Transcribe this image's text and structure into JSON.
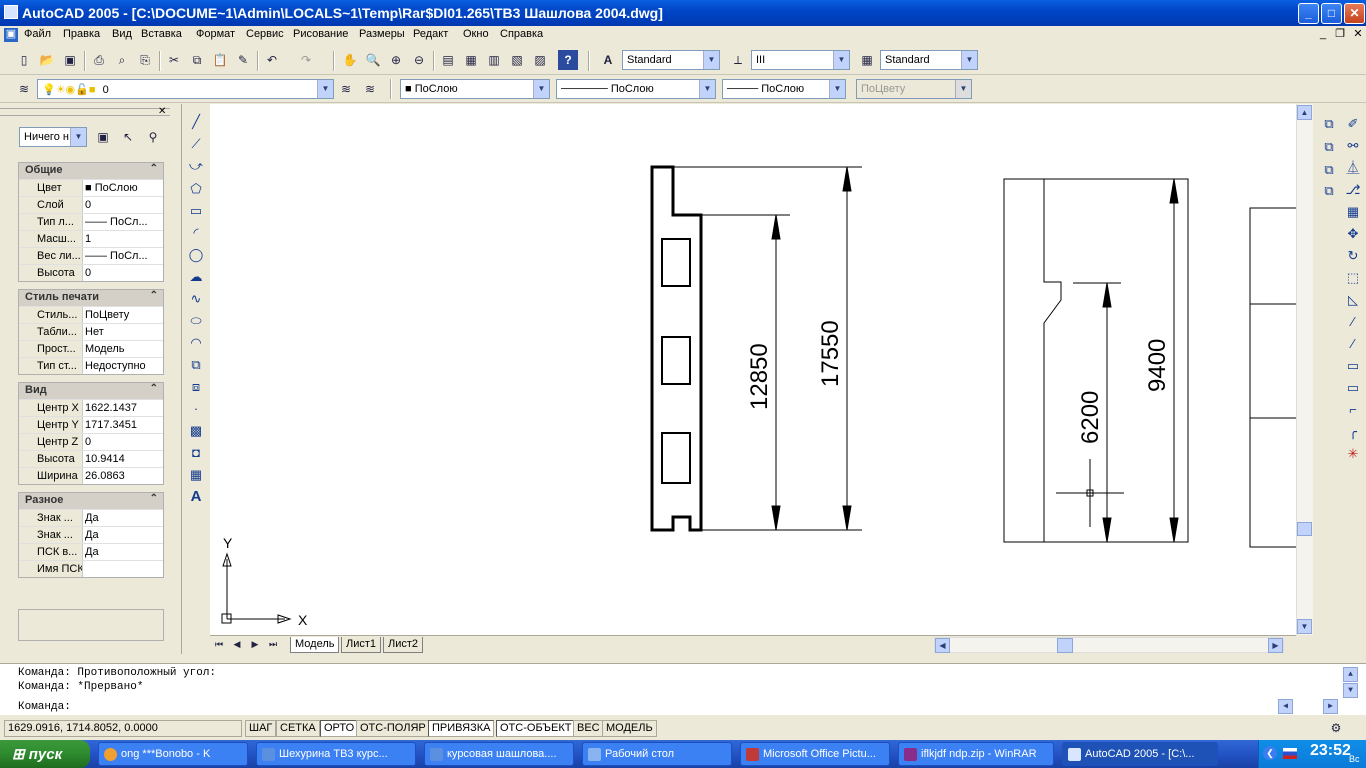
{
  "window": {
    "title": "AutoCAD 2005 - [C:\\DOCUME~1\\Admin\\LOCALS~1\\Temp\\Rar$DI01.265\\ТВ3 Шашлова 2004.dwg]",
    "min": "_",
    "max": "□",
    "close": "✕"
  },
  "menu": {
    "items": [
      "Файл",
      "Правка",
      "Вид",
      "Вставка",
      "Формат",
      "Сервис",
      "Рисование",
      "Размеры",
      "Редакт",
      "Окно",
      "Справка"
    ]
  },
  "toolbar1": {
    "text_style": "Standard",
    "dim_style": "III",
    "table_style": "Standard"
  },
  "toolbar2": {
    "layer": "0",
    "color": "ПоСлою",
    "linetype": "ПоСлою",
    "lineweight": "ПоСлою",
    "plotstyle": "ПоЦвету"
  },
  "props": {
    "select": "Ничего н",
    "general": {
      "title": "Общие",
      "rows": [
        [
          "Цвет",
          "ПоСлою"
        ],
        [
          "Слой",
          "0"
        ],
        [
          "Тип л...",
          "—— ПоСл..."
        ],
        [
          "Масш...",
          "1"
        ],
        [
          "Вес ли...",
          "—— ПоСл..."
        ],
        [
          "Высота",
          "0"
        ]
      ]
    },
    "plot": {
      "title": "Стиль печати",
      "rows": [
        [
          "Стиль...",
          "ПоЦвету"
        ],
        [
          "Табли...",
          "Нет"
        ],
        [
          "Прост...",
          "Модель"
        ],
        [
          "Тип ст...",
          "Недоступно"
        ]
      ]
    },
    "view": {
      "title": "Вид",
      "rows": [
        [
          "Центр X",
          "1622.1437"
        ],
        [
          "Центр Y",
          "1717.3451"
        ],
        [
          "Центр Z",
          "0"
        ],
        [
          "Высота",
          "10.9414"
        ],
        [
          "Ширина",
          "26.0863"
        ]
      ]
    },
    "misc": {
      "title": "Разное",
      "rows": [
        [
          "Знак ...",
          "Да"
        ],
        [
          "Знак ...",
          "Да"
        ],
        [
          "ПСК в...",
          "Да"
        ],
        [
          "Имя ПСК",
          ""
        ]
      ]
    }
  },
  "drawing": {
    "dims": [
      "12850",
      "17550",
      "6200",
      "9400"
    ],
    "ucs_x": "X",
    "ucs_y": "Y"
  },
  "layout_tabs": [
    "Модель",
    "Лист1",
    "Лист2"
  ],
  "command": {
    "lines": [
      "Команда: Противоположный угол:",
      "Команда: *Прервано*"
    ],
    "prompt": "Команда:"
  },
  "status": {
    "coords": "1629.0916, 1714.8052, 0.0000",
    "toggles": [
      "ШАГ",
      "СЕТКА",
      "ОРТО",
      "ОТС-ПОЛЯР",
      "ПРИВЯЗКА",
      "ОТС-ОБЪЕКТ",
      "ВЕС",
      "МОДЕЛЬ"
    ]
  },
  "taskbar": {
    "start": "пуск",
    "tasks": [
      "ong ***Bonobo - K",
      "Шехурина ТВ3 курс...",
      "курсовая шашлова....",
      "Рабочий стол",
      "Microsoft Office Pictu...",
      "iflkjdf ndp.zip - WinRAR",
      "AutoCAD 2005 - [C:\\..."
    ],
    "time": "23:52",
    "day": "Вс"
  }
}
